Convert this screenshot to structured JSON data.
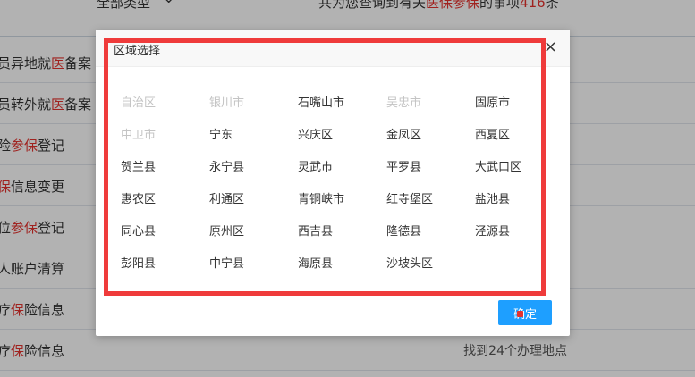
{
  "background": {
    "filter_label": "全部类型",
    "result_prefix": "共为您查询到有关",
    "result_keyword": "医保参保",
    "result_mid": "的事项",
    "result_count": "416",
    "result_suffix": "条",
    "items": [
      {
        "pre": "员异地就",
        "hl": "医",
        "post": "备案",
        "right": ""
      },
      {
        "pre": "员转外就",
        "hl": "医",
        "post": "备案",
        "right": ""
      },
      {
        "pre": "险",
        "hl": "参保",
        "post": "登记",
        "right": ""
      },
      {
        "pre": "",
        "hl": "保",
        "post": "信息变更",
        "right": ""
      },
      {
        "pre": "位",
        "hl": "参保",
        "post": "登记",
        "right": ""
      },
      {
        "pre": "人账户清算",
        "hl": "",
        "post": "",
        "right": ""
      },
      {
        "pre": "疗",
        "hl": "保",
        "post": "险信息",
        "right": ""
      },
      {
        "pre": "疗",
        "hl": "保",
        "post": "险信息",
        "right": "找到24个办理地点"
      }
    ]
  },
  "modal": {
    "title": "区域选择",
    "close_symbol": "×",
    "confirm_label": "确定",
    "regions": [
      {
        "name": "自治区",
        "disabled": true
      },
      {
        "name": "银川市",
        "disabled": true
      },
      {
        "name": "石嘴山市",
        "disabled": false
      },
      {
        "name": "吴忠市",
        "disabled": true
      },
      {
        "name": "固原市",
        "disabled": false
      },
      {
        "name": "中卫市",
        "disabled": true
      },
      {
        "name": "宁东",
        "disabled": false
      },
      {
        "name": "兴庆区",
        "disabled": false
      },
      {
        "name": "金凤区",
        "disabled": false
      },
      {
        "name": "西夏区",
        "disabled": false
      },
      {
        "name": "贺兰县",
        "disabled": false
      },
      {
        "name": "永宁县",
        "disabled": false
      },
      {
        "name": "灵武市",
        "disabled": false
      },
      {
        "name": "平罗县",
        "disabled": false
      },
      {
        "name": "大武口区",
        "disabled": false
      },
      {
        "name": "惠农区",
        "disabled": false
      },
      {
        "name": "利通区",
        "disabled": false
      },
      {
        "name": "青铜峡市",
        "disabled": false
      },
      {
        "name": "红寺堡区",
        "disabled": false
      },
      {
        "name": "盐池县",
        "disabled": false
      },
      {
        "name": "同心县",
        "disabled": false
      },
      {
        "name": "原州区",
        "disabled": false
      },
      {
        "name": "西吉县",
        "disabled": false
      },
      {
        "name": "隆德县",
        "disabled": false
      },
      {
        "name": "泾源县",
        "disabled": false
      },
      {
        "name": "彭阳县",
        "disabled": false
      },
      {
        "name": "中宁县",
        "disabled": false
      },
      {
        "name": "海原县",
        "disabled": false
      },
      {
        "name": "沙坡头区",
        "disabled": false
      }
    ]
  },
  "colors": {
    "accent": "#1e9fff",
    "highlight_text": "#e5322d",
    "annotation_box": "#ef3b3b",
    "disabled_text": "#c4c4c4"
  }
}
